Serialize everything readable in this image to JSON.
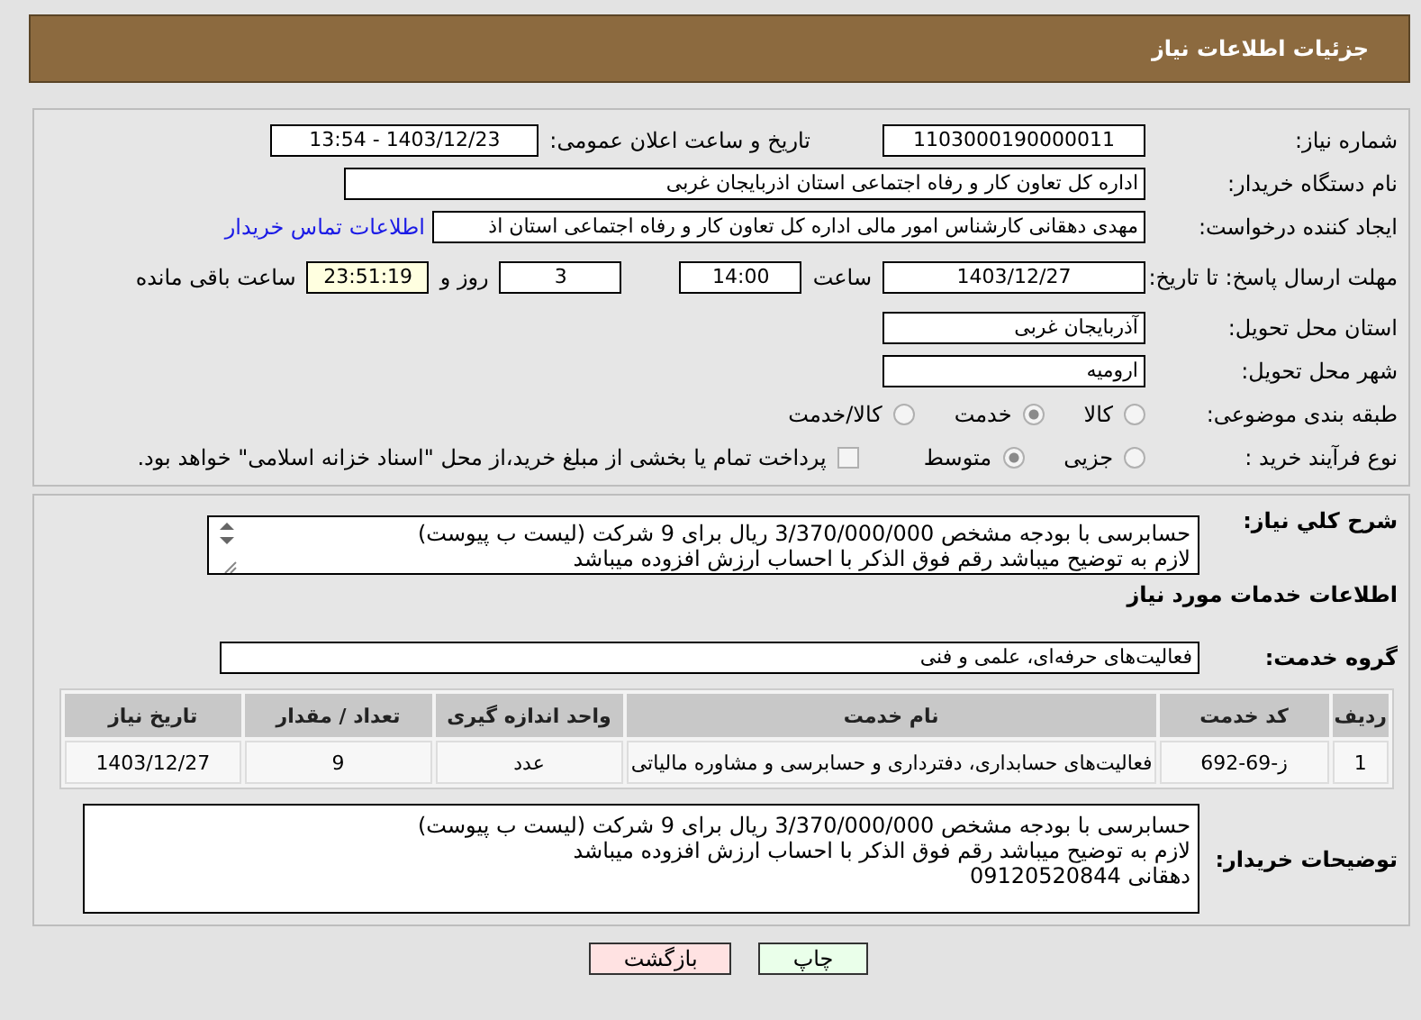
{
  "header": {
    "title": "جزئیات اطلاعات نیاز"
  },
  "need_number": {
    "label": "شماره نیاز:",
    "value": "1103000190000011"
  },
  "announce": {
    "label": "تاریخ و ساعت اعلان عمومی:",
    "value": "1403/12/23 - 13:54"
  },
  "buyer_org": {
    "label": "نام دستگاه خریدار:",
    "value": "اداره کل تعاون  کار و رفاه اجتماعی استان اذربایجان غربی"
  },
  "requester": {
    "label": "ایجاد کننده درخواست:",
    "value": "مهدی دهقانی کارشناس امور مالی اداره کل تعاون  کار و رفاه اجتماعی استان اذ",
    "link": "اطلاعات تماس خریدار"
  },
  "deadline": {
    "label": "مهلت ارسال پاسخ: تا تاریخ:",
    "date": "1403/12/27",
    "time_label": "ساعت",
    "time": "14:00",
    "days": "3",
    "days_label": "روز و",
    "remaining": "23:51:19",
    "remaining_label": "ساعت باقی مانده"
  },
  "province": {
    "label": "استان محل تحویل:",
    "value": "آذربایجان غربی"
  },
  "city": {
    "label": "شهر محل تحویل:",
    "value": "ارومیه"
  },
  "category": {
    "label": "طبقه بندی موضوعی:",
    "options": [
      {
        "label": "کالا",
        "selected": false
      },
      {
        "label": "خدمت",
        "selected": true
      },
      {
        "label": "کالا/خدمت",
        "selected": false
      }
    ]
  },
  "process": {
    "label": "نوع فرآیند خرید :",
    "options": [
      {
        "label": "جزیی",
        "selected": false
      },
      {
        "label": "متوسط",
        "selected": true
      }
    ],
    "checkbox": {
      "label": "پرداخت تمام یا بخشی از مبلغ خرید،از محل \"اسناد خزانه اسلامی\" خواهد بود.",
      "checked": false
    }
  },
  "description": {
    "label": "شرح کلي نياز:",
    "lines": [
      "حسابرسی با بودجه مشخص 3/370/000/000 ریال برای 9 شرکت (لیست ب پیوست)",
      "لازم به توضیح میباشد رقم فوق الذکر با احساب ارزش افزوده میباشد"
    ]
  },
  "services_title": "اطلاعات خدمات مورد نياز",
  "service_group": {
    "label": "گروه خدمت:",
    "value": "فعالیت‌های حرفه‌ای، علمی و فنی"
  },
  "table": {
    "columns": [
      "ردیف",
      "کد خدمت",
      "نام خدمت",
      "واحد اندازه گیری",
      "تعداد / مقدار",
      "تاریخ نیاز"
    ],
    "rows": [
      [
        "1",
        "ز-69-692",
        "فعالیت‌های حسابداری، دفترداری و حسابرسی و مشاوره مالیاتی",
        "عدد",
        "9",
        "1403/12/27"
      ]
    ]
  },
  "buyer_notes": {
    "label": "توضیحات خریدار:",
    "lines": [
      "حسابرسی با بودجه مشخص 3/370/000/000 ریال برای 9 شرکت (لیست ب پیوست)",
      "لازم به توضیح میباشد رقم فوق الذکر با احساب ارزش افزوده میباشد",
      "دهقانی 09120520844"
    ]
  },
  "buttons": [
    {
      "label": "چاپ",
      "kind": "print"
    },
    {
      "label": "بازگشت",
      "kind": "back"
    }
  ]
}
